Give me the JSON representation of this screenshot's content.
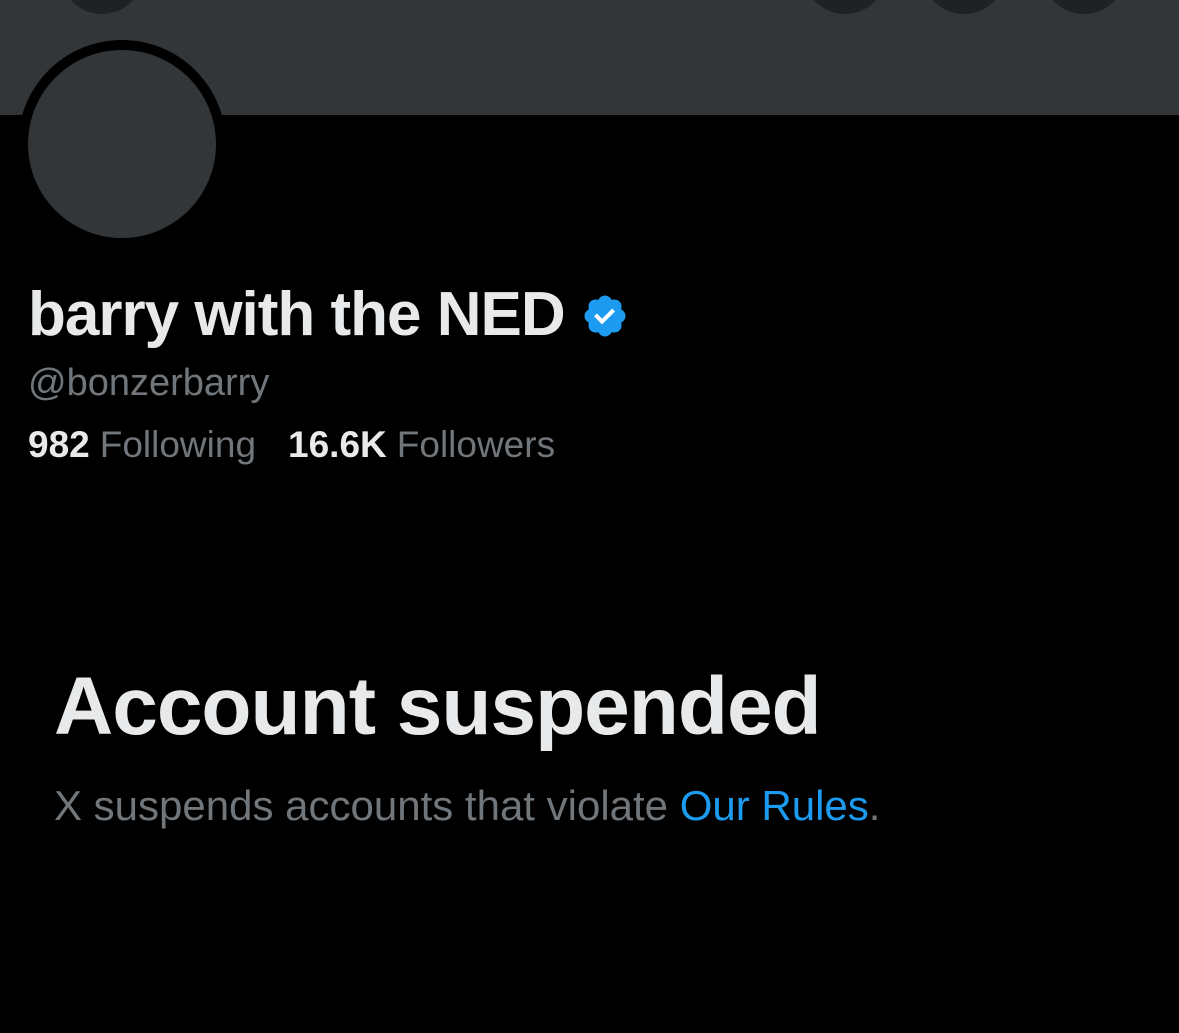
{
  "profile": {
    "display_name": "barry with the NED",
    "verified_icon": "verified-badge-icon",
    "handle": "@bonzerbarry",
    "following_count": "982",
    "following_label": "Following",
    "followers_count": "16.6K",
    "followers_label": "Followers"
  },
  "suspension": {
    "title": "Account suspended",
    "desc_prefix": "X suspends accounts that violate ",
    "rules_link": "Our Rules",
    "desc_suffix": "."
  },
  "colors": {
    "background": "#000000",
    "banner": "#333639",
    "primary_text": "#e7e9ea",
    "secondary_text": "#71767b",
    "accent": "#1d9bf0"
  },
  "icons": {
    "header_buttons": [
      "back-arrow-icon",
      "search-icon",
      "share-icon",
      "more-icon"
    ]
  }
}
